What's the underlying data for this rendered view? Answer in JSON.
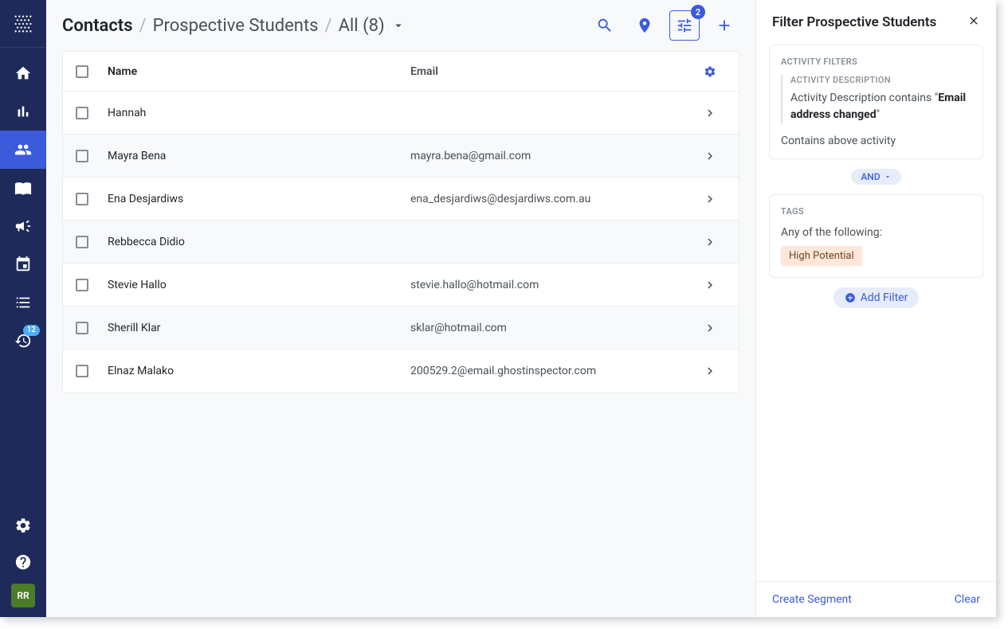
{
  "header": {
    "breadcrumb_root": "Contacts",
    "breadcrumb_mid": "Prospective Students",
    "breadcrumb_last": "All (8)",
    "filter_count": "2"
  },
  "sidebar": {
    "activity_badge": "12",
    "avatar_initials": "RR"
  },
  "table": {
    "col_name": "Name",
    "col_email": "Email",
    "rows": [
      {
        "name": "Hannah",
        "email": ""
      },
      {
        "name": "Mayra Bena",
        "email": "mayra.bena@gmail.com"
      },
      {
        "name": "Ena Desjardiws",
        "email": "ena_desjardiws@desjardiws.com.au"
      },
      {
        "name": "Rebbecca Didio",
        "email": ""
      },
      {
        "name": "Stevie Hallo",
        "email": "stevie.hallo@hotmail.com"
      },
      {
        "name": "Sherill Klar",
        "email": "sklar@hotmail.com"
      },
      {
        "name": "Elnaz Malako",
        "email": "200529.2@email.ghostinspector.com"
      }
    ]
  },
  "filter_panel": {
    "title": "Filter Prospective Students",
    "activity": {
      "label": "ACTIVITY FILTERS",
      "sublabel": "ACTIVITY DESCRIPTION",
      "text_prefix": "Activity Description contains \"",
      "text_bold": "Email address changed",
      "text_suffix": "\"",
      "footer": "Contains above activity"
    },
    "operator": "AND",
    "tags": {
      "label": "TAGS",
      "text": "Any of the following:",
      "tag": "High Potential"
    },
    "add_filter": "Add Filter",
    "create_segment": "Create Segment",
    "clear": "Clear"
  }
}
